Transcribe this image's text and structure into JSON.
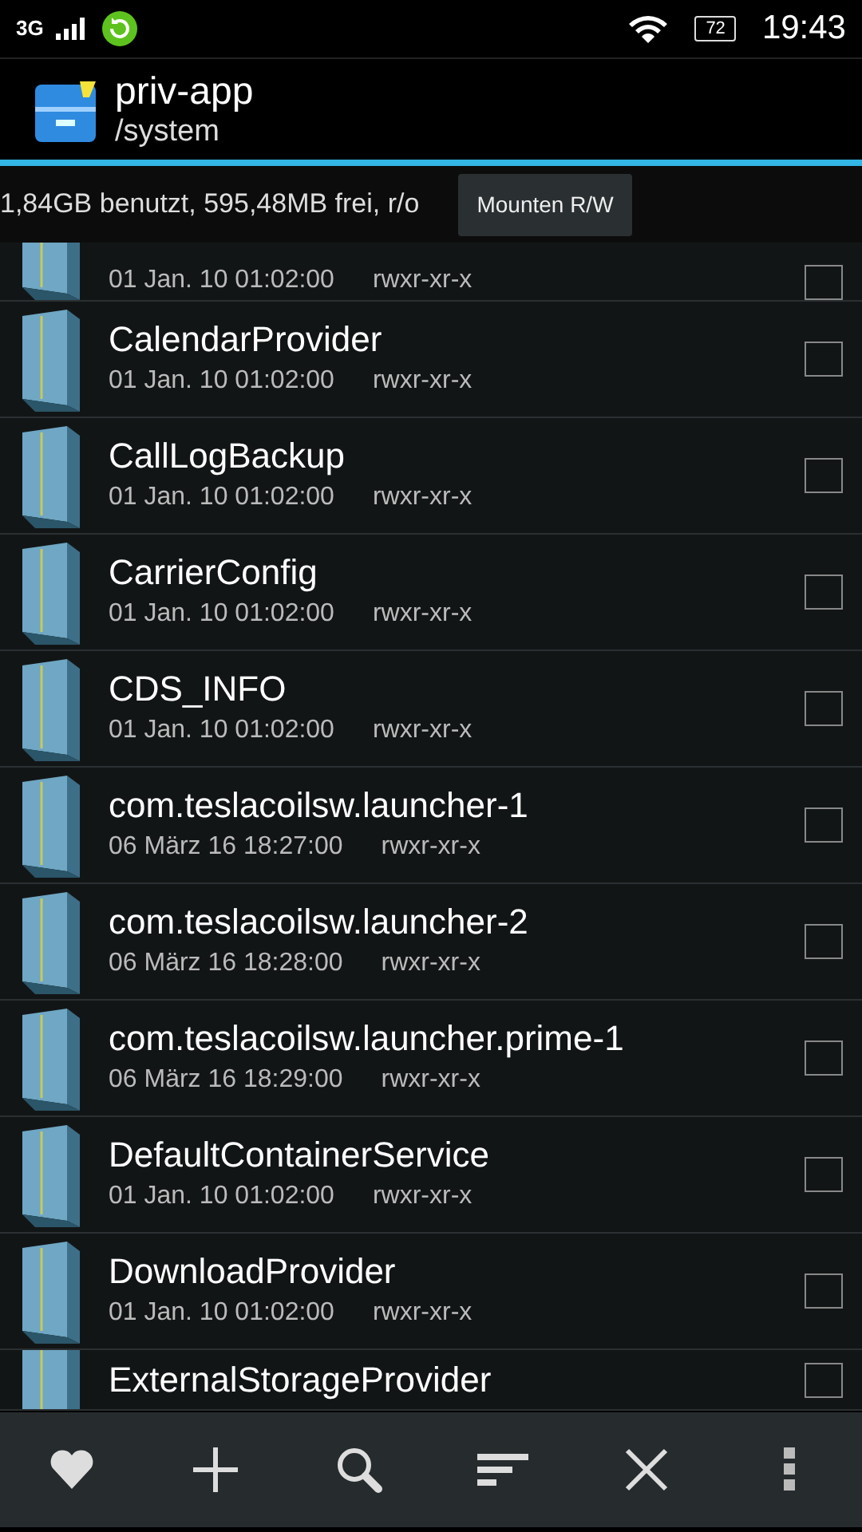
{
  "status_bar": {
    "network": "3G",
    "battery": "72",
    "time": "19:43"
  },
  "header": {
    "title": "priv-app",
    "path": "/system"
  },
  "storage": {
    "text": "1,84GB benutzt, 595,48MB frei, r/o",
    "button": "Mounten R/W"
  },
  "files": [
    {
      "date": "01 Jan. 10 01:02:00",
      "perms": "rwxr-xr-x",
      "checked": false
    },
    {
      "name": "CalendarProvider",
      "date": "01 Jan. 10 01:02:00",
      "perms": "rwxr-xr-x",
      "checked": false
    },
    {
      "name": "CallLogBackup",
      "date": "01 Jan. 10 01:02:00",
      "perms": "rwxr-xr-x",
      "checked": false
    },
    {
      "name": "CarrierConfig",
      "date": "01 Jan. 10 01:02:00",
      "perms": "rwxr-xr-x",
      "checked": false
    },
    {
      "name": "CDS_INFO",
      "date": "01 Jan. 10 01:02:00",
      "perms": "rwxr-xr-x",
      "checked": false
    },
    {
      "name": "com.teslacoilsw.launcher-1",
      "date": "06 März 16 18:27:00",
      "perms": "rwxr-xr-x",
      "checked": false
    },
    {
      "name": "com.teslacoilsw.launcher-2",
      "date": "06 März 16 18:28:00",
      "perms": "rwxr-xr-x",
      "checked": false
    },
    {
      "name": "com.teslacoilsw.launcher.prime-1",
      "date": "06 März 16 18:29:00",
      "perms": "rwxr-xr-x",
      "checked": false
    },
    {
      "name": "DefaultContainerService",
      "date": "01 Jan. 10 01:02:00",
      "perms": "rwxr-xr-x",
      "checked": false
    },
    {
      "name": "DownloadProvider",
      "date": "01 Jan. 10 01:02:00",
      "perms": "rwxr-xr-x",
      "checked": false
    },
    {
      "name": "ExternalStorageProvider",
      "checked": false
    }
  ],
  "toolbar": [
    {
      "kind": "favorite"
    },
    {
      "kind": "add"
    },
    {
      "kind": "search"
    },
    {
      "kind": "sort"
    },
    {
      "kind": "close"
    },
    {
      "kind": "more"
    }
  ]
}
